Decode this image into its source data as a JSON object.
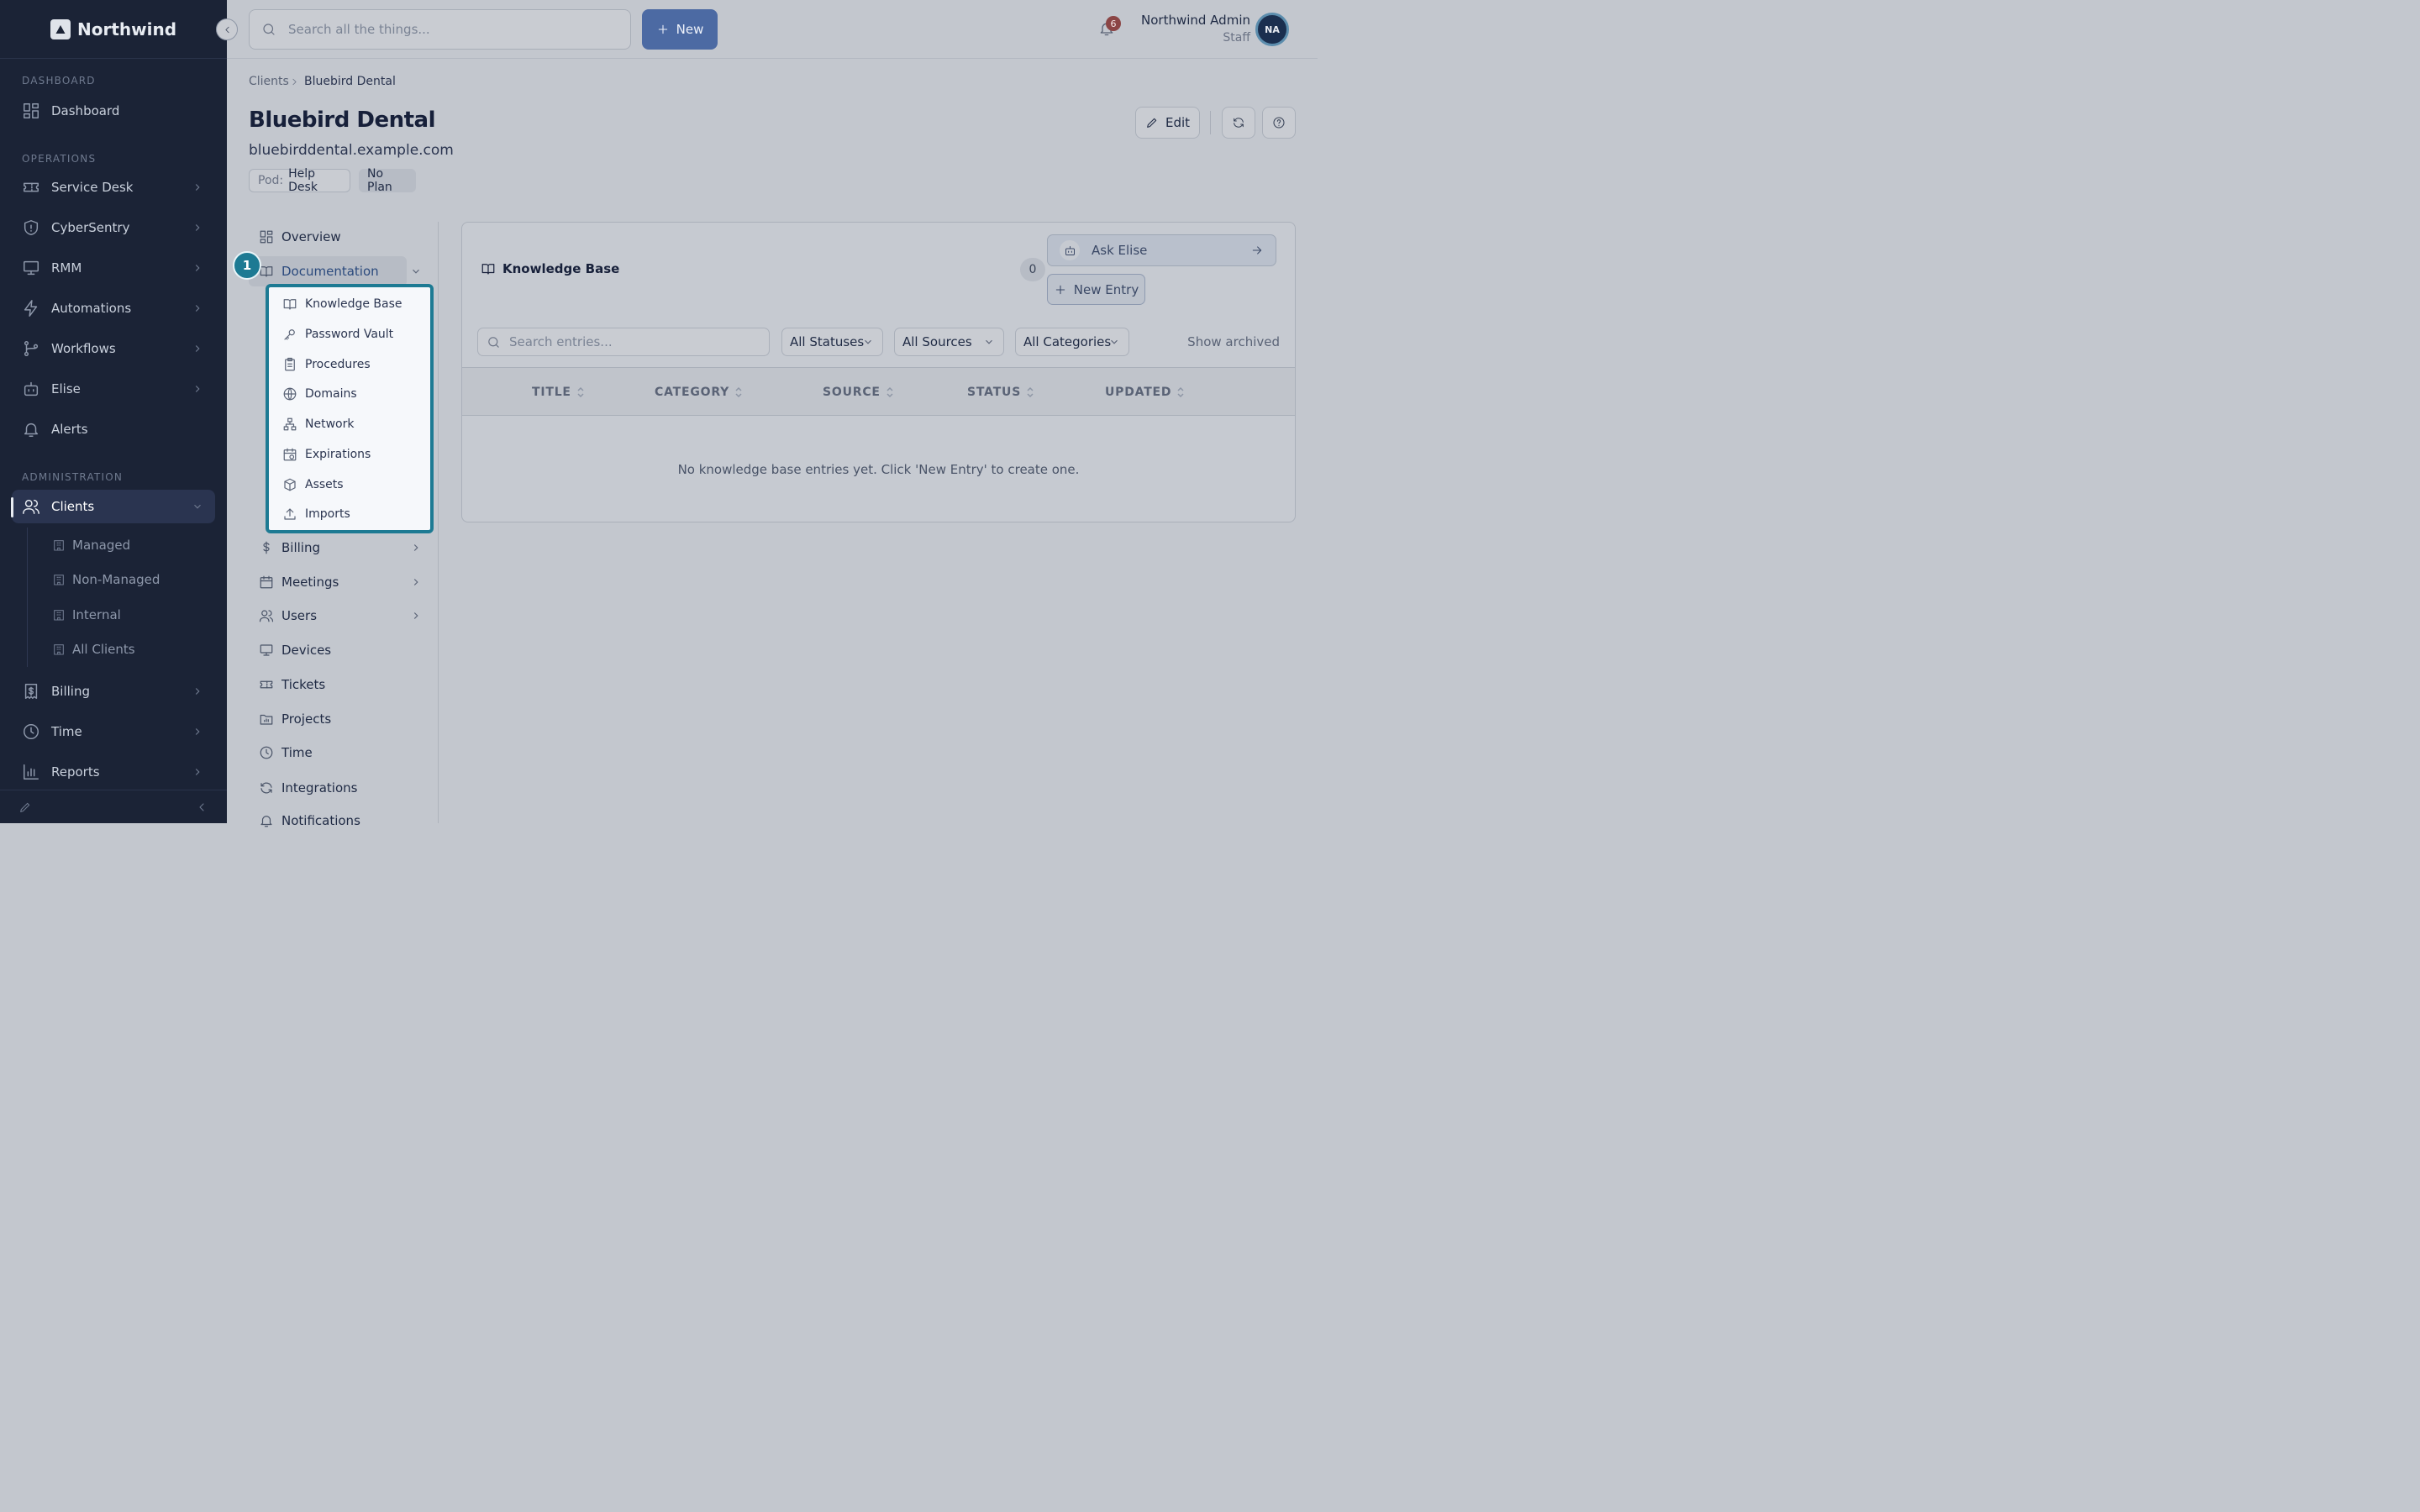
{
  "app": {
    "brand": "Northwind"
  },
  "sidebar": {
    "sections": {
      "dashboard": "DASHBOARD",
      "operations": "OPERATIONS",
      "administration": "ADMINISTRATION"
    },
    "items": [
      {
        "label": "Dashboard",
        "icon": "dashboard-icon"
      },
      {
        "label": "Service Desk",
        "icon": "ticket-icon"
      },
      {
        "label": "CyberSentry",
        "icon": "shield-icon"
      },
      {
        "label": "RMM",
        "icon": "monitor-icon"
      },
      {
        "label": "Automations",
        "icon": "lightning-icon"
      },
      {
        "label": "Workflows",
        "icon": "workflow-icon"
      },
      {
        "label": "Elise",
        "icon": "bot-icon"
      },
      {
        "label": "Alerts",
        "icon": "bell-icon"
      },
      {
        "label": "Clients",
        "icon": "users-icon"
      },
      {
        "label": "Billing",
        "icon": "receipt-icon"
      },
      {
        "label": "Time",
        "icon": "clock-icon"
      },
      {
        "label": "Reports",
        "icon": "chart-icon"
      }
    ],
    "clients_sub": [
      "Managed",
      "Non-Managed",
      "Internal",
      "All Clients"
    ]
  },
  "topbar": {
    "search_placeholder": "Search all the things...",
    "new_label": "New",
    "notifications_count": "6",
    "user_name": "Northwind Admin",
    "user_role": "Staff",
    "avatar_initials": "NA"
  },
  "breadcrumb": {
    "root": "Clients",
    "current": "Bluebird Dental"
  },
  "client": {
    "name": "Bluebird Dental",
    "domain": "bluebirddental.example.com",
    "pod_label": "Pod:",
    "pod_value": "Help Desk",
    "plan": "No Plan",
    "edit_label": "Edit"
  },
  "docnav": {
    "overview": "Overview",
    "documentation": "Documentation",
    "step_number": "1",
    "doc_items": [
      "Knowledge Base",
      "Password Vault",
      "Procedures",
      "Domains",
      "Network",
      "Expirations",
      "Assets",
      "Imports"
    ],
    "after": [
      "Billing",
      "Meetings",
      "Users",
      "Devices",
      "Tickets",
      "Projects",
      "Time",
      "Integrations",
      "Notifications"
    ]
  },
  "kb": {
    "title": "Knowledge Base",
    "count": "0",
    "ask_label": "Ask Elise",
    "new_entry_label": "New Entry",
    "search_placeholder": "Search entries...",
    "filters": [
      "All Statuses",
      "All Sources",
      "All Categories"
    ],
    "show_archived": "Show archived",
    "columns": [
      "TITLE",
      "CATEGORY",
      "SOURCE",
      "STATUS",
      "UPDATED"
    ],
    "empty_message": "No knowledge base entries yet. Click 'New Entry' to create one."
  }
}
